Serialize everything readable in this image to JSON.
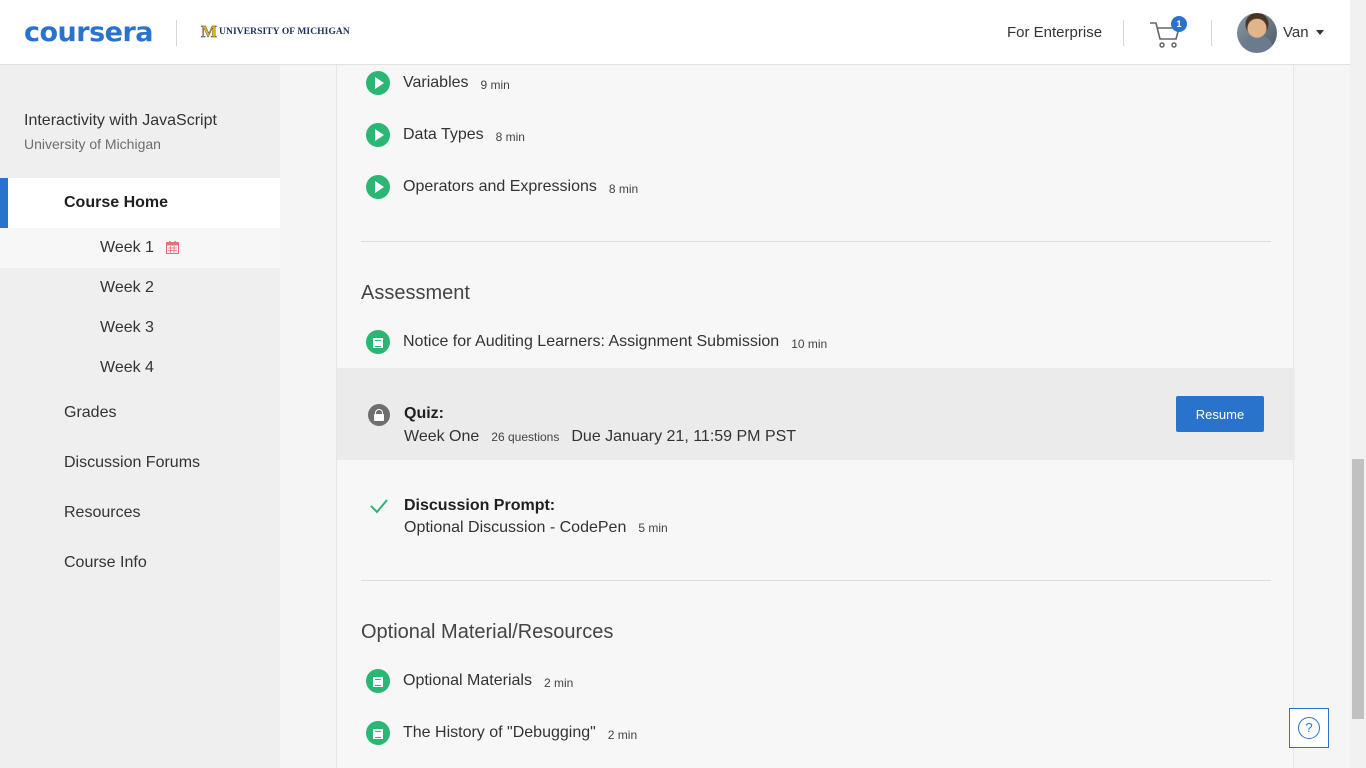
{
  "header": {
    "logo": "coursera",
    "partner_name": "UNIVERSITY OF MICHIGAN",
    "enterprise_link": "For Enterprise",
    "cart_count": "1",
    "user_name": "Van"
  },
  "sidebar": {
    "course_title": "Interactivity with JavaScript",
    "course_org": "University of Michigan",
    "home_label": "Course Home",
    "weeks": [
      "Week 1",
      "Week 2",
      "Week 3",
      "Week 4"
    ],
    "items": [
      "Grades",
      "Discussion Forums",
      "Resources",
      "Course Info"
    ]
  },
  "main": {
    "lectures": [
      {
        "title": "Variables",
        "duration": "9 min"
      },
      {
        "title": "Data Types",
        "duration": "8 min"
      },
      {
        "title": "Operators and Expressions",
        "duration": "8 min"
      }
    ],
    "assessment": {
      "heading": "Assessment",
      "notice": {
        "title": "Notice for Auditing Learners: Assignment Submission",
        "duration": "10 min"
      },
      "quiz": {
        "label": "Quiz:",
        "name": "Week One",
        "questions": "26 questions",
        "due": "Due January 21, 11:59 PM PST",
        "button": "Resume"
      },
      "discussion": {
        "label": "Discussion Prompt:",
        "name": "Optional Discussion - CodePen",
        "duration": "5 min"
      }
    },
    "optional": {
      "heading": "Optional Material/Resources",
      "items": [
        {
          "title": "Optional Materials",
          "duration": "2 min"
        },
        {
          "title": "The History of \"Debugging\"",
          "duration": "2 min"
        }
      ]
    }
  },
  "help": {
    "label": "?"
  },
  "colors": {
    "brand": "#2a73cc",
    "complete": "#2bb673",
    "partner": "#f5b800"
  }
}
